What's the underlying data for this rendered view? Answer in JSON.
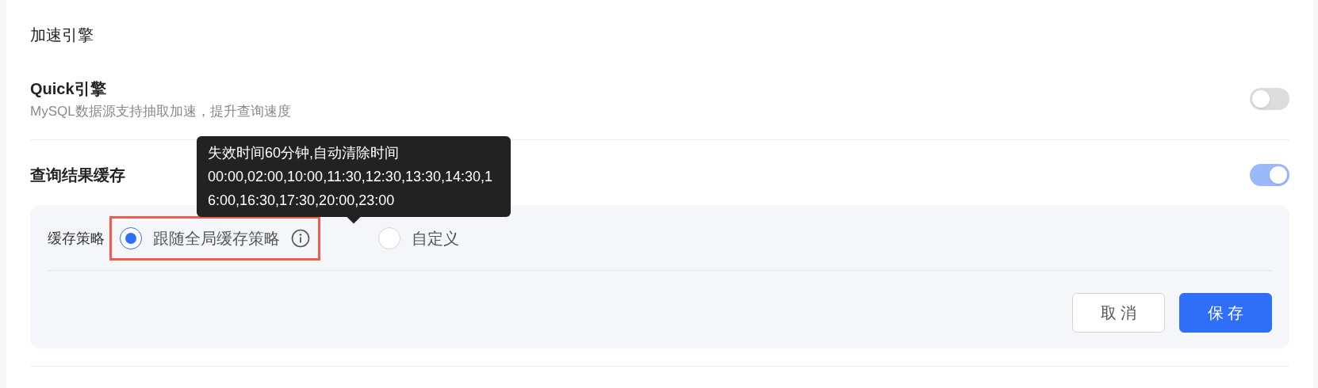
{
  "section_title": "加速引擎",
  "settings": [
    {
      "title": "Quick引擎",
      "description": "MySQL数据源支持抽取加速，提升查询速度",
      "on": false
    },
    {
      "title": "查询结果缓存",
      "on": true
    }
  ],
  "cache_panel": {
    "label": "缓存策略",
    "options": [
      {
        "label": "跟随全局缓存策略",
        "selected": true,
        "info": true,
        "highlighted": true
      },
      {
        "label": "自定义",
        "selected": false,
        "info": false,
        "highlighted": false
      }
    ],
    "buttons": [
      {
        "label": "取 消",
        "kind": "secondary"
      },
      {
        "label": "保 存",
        "kind": "primary"
      }
    ]
  },
  "tooltip": {
    "lines": [
      "失效时间60分钟,自动清除时间",
      "00:00,02:00,10:00,11:30,12:30,13:30,14:30,16:00,16:30,17:30,20:00,23:00"
    ]
  }
}
